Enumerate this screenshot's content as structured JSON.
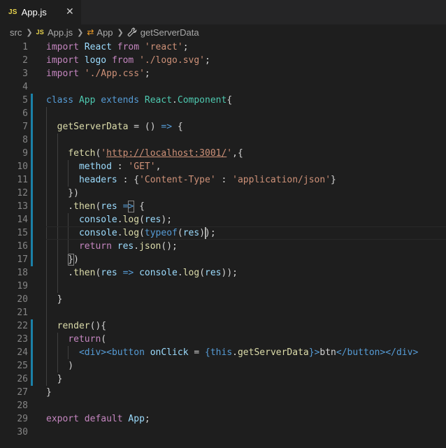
{
  "tab": {
    "badge": "JS",
    "filename": "App.js",
    "close": "✕"
  },
  "breadcrumbs": {
    "folder": "src",
    "file_badge": "JS",
    "file": "App.js",
    "class_icon": "class-icon",
    "class": "App",
    "method_icon": "method-wrench-icon",
    "method": "getServerData"
  },
  "editor": {
    "language": "javascript",
    "cursor": {
      "line": 15,
      "column": 29
    },
    "lines": [
      {
        "n": "1",
        "tokens": [
          [
            "import",
            "kw-ctl"
          ],
          [
            " "
          ],
          [
            "React",
            "var"
          ],
          [
            " "
          ],
          [
            "from",
            "kw-ctl"
          ],
          [
            " "
          ],
          [
            "'react'",
            "str"
          ],
          [
            ";"
          ]
        ]
      },
      {
        "n": "2",
        "tokens": [
          [
            "import",
            "kw-ctl"
          ],
          [
            " "
          ],
          [
            "logo",
            "var"
          ],
          [
            " "
          ],
          [
            "from",
            "kw-ctl"
          ],
          [
            " "
          ],
          [
            "'./logo.svg'",
            "str"
          ],
          [
            ";"
          ]
        ]
      },
      {
        "n": "3",
        "tokens": [
          [
            "import",
            "kw-ctl"
          ],
          [
            " "
          ],
          [
            "'./App.css'",
            "str"
          ],
          [
            ";"
          ]
        ]
      },
      {
        "n": "4",
        "tokens": []
      },
      {
        "n": "5",
        "tokens": [
          [
            "class",
            "kw"
          ],
          [
            " "
          ],
          [
            "App",
            "cls"
          ],
          [
            " "
          ],
          [
            "extends",
            "kw"
          ],
          [
            " "
          ],
          [
            "React",
            "cls"
          ],
          [
            "."
          ],
          [
            "Component",
            "cls"
          ],
          [
            "{"
          ]
        ]
      },
      {
        "n": "6",
        "tokens": []
      },
      {
        "n": "7",
        "tokens": [
          [
            "  "
          ],
          [
            "getServerData",
            "fn"
          ],
          [
            " = () "
          ],
          [
            "=>",
            "kw"
          ],
          [
            " {"
          ]
        ]
      },
      {
        "n": "8",
        "tokens": []
      },
      {
        "n": "9",
        "tokens": [
          [
            "    "
          ],
          [
            "fetch",
            "fn"
          ],
          [
            "("
          ],
          [
            "'",
            "str"
          ],
          [
            "http://localhost:3001/",
            "url"
          ],
          [
            "'",
            "str"
          ],
          [
            ",{"
          ]
        ]
      },
      {
        "n": "10",
        "tokens": [
          [
            "      "
          ],
          [
            "method",
            "var"
          ],
          [
            " : "
          ],
          [
            "'GET'",
            "str"
          ],
          [
            ","
          ]
        ]
      },
      {
        "n": "11",
        "tokens": [
          [
            "      "
          ],
          [
            "headers",
            "var"
          ],
          [
            " : {"
          ],
          [
            "'Content-Type'",
            "str"
          ],
          [
            " : "
          ],
          [
            "'application/json'",
            "str"
          ],
          [
            "}"
          ]
        ]
      },
      {
        "n": "12",
        "tokens": [
          [
            "    })"
          ]
        ]
      },
      {
        "n": "13",
        "tokens": [
          [
            "    ."
          ],
          [
            "then",
            "fn"
          ],
          [
            "("
          ],
          [
            "res",
            "var"
          ],
          [
            " "
          ],
          [
            "=>",
            "kw"
          ],
          [
            " {"
          ]
        ]
      },
      {
        "n": "14",
        "tokens": [
          [
            "      "
          ],
          [
            "console",
            "var"
          ],
          [
            "."
          ],
          [
            "log",
            "fn"
          ],
          [
            "("
          ],
          [
            "res",
            "var"
          ],
          [
            ");"
          ]
        ]
      },
      {
        "n": "15",
        "tokens": [
          [
            "      "
          ],
          [
            "console",
            "var"
          ],
          [
            "."
          ],
          [
            "log",
            "fn"
          ],
          [
            "("
          ],
          [
            "typeof",
            "kw"
          ],
          [
            "("
          ],
          [
            "res",
            "var"
          ],
          [
            "));"
          ]
        ]
      },
      {
        "n": "16",
        "tokens": [
          [
            "      "
          ],
          [
            "return",
            "kw-ctl"
          ],
          [
            " "
          ],
          [
            "res",
            "var"
          ],
          [
            "."
          ],
          [
            "json",
            "fn"
          ],
          [
            "();"
          ]
        ]
      },
      {
        "n": "17",
        "tokens": [
          [
            "    })"
          ]
        ]
      },
      {
        "n": "18",
        "tokens": [
          [
            "    ."
          ],
          [
            "then",
            "fn"
          ],
          [
            "("
          ],
          [
            "res",
            "var"
          ],
          [
            " "
          ],
          [
            "=>",
            "kw"
          ],
          [
            " "
          ],
          [
            "console",
            "var"
          ],
          [
            "."
          ],
          [
            "log",
            "fn"
          ],
          [
            "("
          ],
          [
            "res",
            "var"
          ],
          [
            "));"
          ]
        ]
      },
      {
        "n": "19",
        "tokens": []
      },
      {
        "n": "20",
        "tokens": [
          [
            "  }"
          ]
        ]
      },
      {
        "n": "21",
        "tokens": []
      },
      {
        "n": "22",
        "tokens": [
          [
            "  "
          ],
          [
            "render",
            "fn"
          ],
          [
            "(){"
          ]
        ]
      },
      {
        "n": "23",
        "tokens": [
          [
            "    "
          ],
          [
            "return",
            "kw-ctl"
          ],
          [
            "("
          ]
        ]
      },
      {
        "n": "24",
        "tokens": [
          [
            "      "
          ],
          [
            "<",
            "tag"
          ],
          [
            "div",
            "tname"
          ],
          [
            ">",
            "tag"
          ],
          [
            "<",
            "tag"
          ],
          [
            "button",
            "tname"
          ],
          [
            " "
          ],
          [
            "onClick",
            "attr"
          ],
          [
            " = "
          ],
          [
            "{",
            "kw"
          ],
          [
            "this",
            "kw"
          ],
          [
            "."
          ],
          [
            "getServerData",
            "fn"
          ],
          [
            "}",
            "kw"
          ],
          [
            ">",
            "tag"
          ],
          [
            "btn",
            "txt"
          ],
          [
            "</",
            "tag"
          ],
          [
            "button",
            "tname"
          ],
          [
            ">",
            "tag"
          ],
          [
            "</",
            "tag"
          ],
          [
            "div",
            "tname"
          ],
          [
            ">",
            "tag"
          ]
        ]
      },
      {
        "n": "25",
        "tokens": [
          [
            "    )"
          ]
        ]
      },
      {
        "n": "26",
        "tokens": [
          [
            "  }"
          ]
        ]
      },
      {
        "n": "27",
        "tokens": [
          [
            "}"
          ]
        ]
      },
      {
        "n": "28",
        "tokens": []
      },
      {
        "n": "29",
        "tokens": [
          [
            "export",
            "kw-ctl"
          ],
          [
            " "
          ],
          [
            "default",
            "kw-ctl"
          ],
          [
            " "
          ],
          [
            "App",
            "var"
          ],
          [
            ";"
          ]
        ]
      },
      {
        "n": "30",
        "tokens": []
      }
    ]
  }
}
